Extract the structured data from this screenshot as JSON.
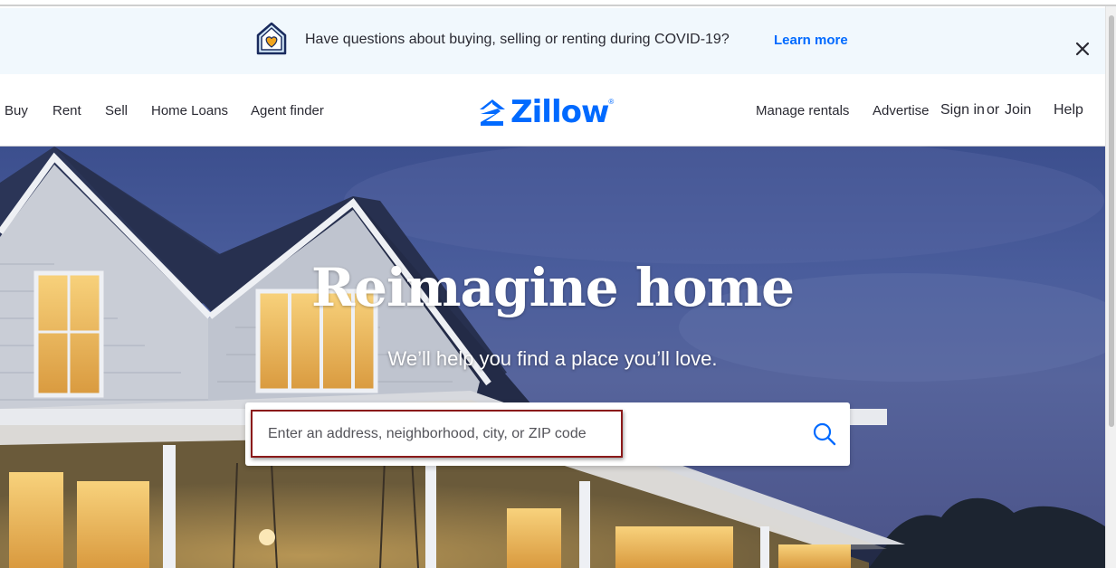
{
  "banner": {
    "icon": "house-heart-icon",
    "text": "Have questions about buying, selling or renting during COVID-19?",
    "link_label": "Learn more",
    "close_icon": "close-icon"
  },
  "nav": {
    "left": [
      {
        "label": "Buy"
      },
      {
        "label": "Rent"
      },
      {
        "label": "Sell"
      },
      {
        "label": "Home Loans"
      },
      {
        "label": "Agent finder"
      }
    ],
    "right": [
      {
        "label": "Manage rentals"
      },
      {
        "label": "Advertise"
      },
      {
        "label": "Sign in"
      },
      {
        "label": "or"
      },
      {
        "label": "Join"
      },
      {
        "label": "Help"
      }
    ]
  },
  "logo": {
    "text": "Zillow",
    "reg": "®",
    "icon": "zillow-z-icon"
  },
  "hero": {
    "title": "Reimagine home",
    "subtitle": "We’ll help you find a place you’ll love.",
    "search": {
      "placeholder": "Enter an address, neighborhood, city, or ZIP code",
      "value": "",
      "icon": "search-icon"
    }
  },
  "colors": {
    "brand": "#006aff",
    "banner_bg": "#f1f8fd",
    "text": "#2a2a33",
    "highlight_border": "#8b1a1a"
  }
}
